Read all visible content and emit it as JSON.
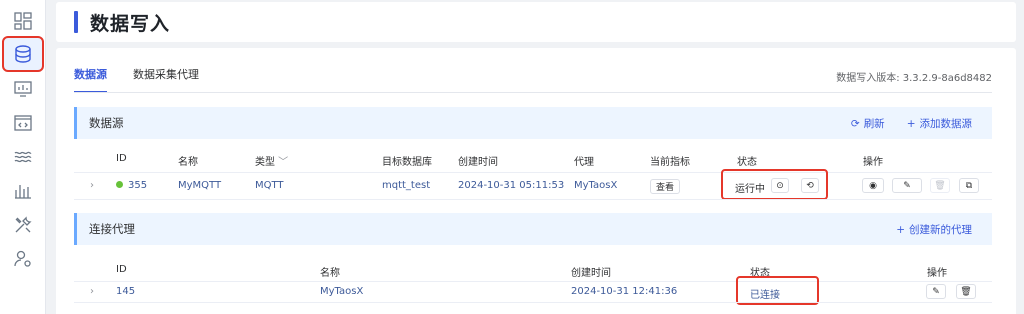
{
  "page_title": "数据写入",
  "tabs": [
    {
      "label": "数据源",
      "active": true
    },
    {
      "label": "数据采集代理",
      "active": false
    }
  ],
  "version_text": "数据写入版本: 3.3.2.9-8a6d8482",
  "sidebar": {
    "icons": [
      "dashboard-icon",
      "database-icon",
      "monitor-chart-icon",
      "code-window-icon",
      "stream-waves-icon",
      "sliders-icon",
      "tools-icon",
      "user-settings-icon"
    ],
    "active_index": 1
  },
  "datasource_section": {
    "title": "数据源",
    "refresh_label": "刷新",
    "add_label": "添加数据源",
    "columns": {
      "id": "ID",
      "name": "名称",
      "type": "类型",
      "target_db": "目标数据库",
      "created": "创建时间",
      "agent": "代理",
      "metrics": "当前指标",
      "status": "状态",
      "actions": "操作"
    },
    "rows": [
      {
        "id": "355",
        "name": "MyMQTT",
        "type": "MQTT",
        "target_db": "mqtt_test",
        "created": "2024-10-31 05:11:53",
        "agent": "MyTaosX",
        "metrics_button": "查看",
        "status": "运行中",
        "status_color": "#67c23a"
      }
    ]
  },
  "agent_section": {
    "title": "连接代理",
    "create_label": "创建新的代理",
    "columns": {
      "id": "ID",
      "name": "名称",
      "created": "创建时间",
      "status": "状态",
      "actions": "操作"
    },
    "rows": [
      {
        "id": "145",
        "name": "MyTaosX",
        "created": "2024-10-31 12:41:36",
        "status": "已连接"
      }
    ]
  },
  "colors": {
    "accent": "#3b5bdb",
    "highlight_box": "#e5372a",
    "section_bg": "#edf5ff"
  }
}
